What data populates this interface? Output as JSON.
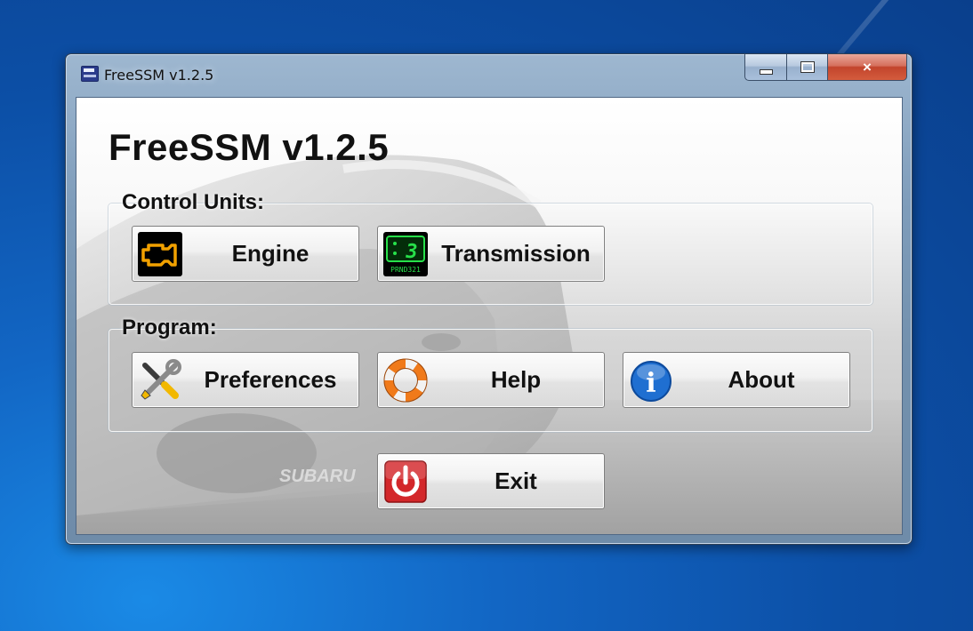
{
  "window": {
    "title": "FreeSSM v1.2.5",
    "controls": {
      "minimize": "minimize",
      "maximize": "maximize",
      "close": "×"
    }
  },
  "app": {
    "heading": "FreeSSM v1.2.5"
  },
  "control_units": {
    "label": "Control Units:",
    "buttons": [
      {
        "label": "Engine",
        "icon": "check-engine-icon"
      },
      {
        "label": "Transmission",
        "icon": "gear-display-icon",
        "display_digit": "3",
        "display_gears": "PRND321"
      }
    ]
  },
  "program": {
    "label": "Program:",
    "buttons": [
      {
        "label": "Preferences",
        "icon": "tools-icon"
      },
      {
        "label": "Help",
        "icon": "lifebuoy-icon"
      },
      {
        "label": "About",
        "icon": "info-icon",
        "glyph": "i"
      }
    ]
  },
  "exit_button": {
    "label": "Exit",
    "icon": "power-icon"
  },
  "background_photo": {
    "badge_text": "SUBARU"
  },
  "colors": {
    "desktop_blue": "#0c4fa6",
    "engine_amber": "#f2a100",
    "transmission_green": "#27e04a",
    "info_blue": "#1f6fd1",
    "exit_red": "#d3272a",
    "lifebuoy_orange": "#f07a1a"
  }
}
